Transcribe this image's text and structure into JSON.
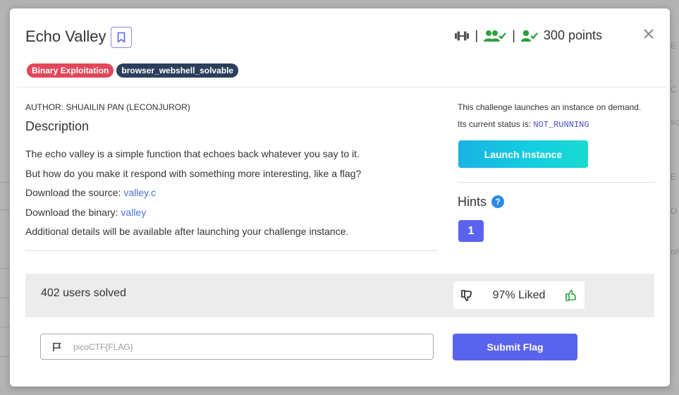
{
  "background": {
    "right_edge_fragments": [
      "E",
      "-C",
      "sc",
      "E",
      "O",
      "olv"
    ]
  },
  "header": {
    "title": "Echo Valley",
    "points": "300 points",
    "separator": "|"
  },
  "tags": [
    {
      "label": "Binary Exploitation",
      "color": "#e2475a"
    },
    {
      "label": "browser_webshell_solvable",
      "color": "#2c3e5c"
    }
  ],
  "details": {
    "author": "AUTHOR: SHUAILIN PAN (LECONJUROR)",
    "description_heading": "Description",
    "line1": "The echo valley is a simple function that echoes back whatever you say to it.",
    "line2": "But how do you make it respond with something more interesting, like a flag?",
    "source_prefix": "Download the source: ",
    "source_link": "valley.c",
    "binary_prefix": "Download the binary: ",
    "binary_link": "valley",
    "line5": "Additional details will be available after launching your challenge instance."
  },
  "instance": {
    "line1": "This challenge launches an instance on demand.",
    "status_prefix": "Its current status is: ",
    "status": "NOT_RUNNING",
    "launch_label": "Launch Instance"
  },
  "hints": {
    "label": "Hints",
    "help_glyph": "?",
    "items": [
      "1"
    ]
  },
  "stats": {
    "solved": "402 users solved",
    "liked": "97% Liked"
  },
  "flag": {
    "placeholder": "picoCTF{FLAG}",
    "value": "",
    "submit_label": "Submit Flag"
  },
  "icons": {
    "difficulty": "dumbbell-icon",
    "solved_users": "users-check-icon",
    "user_check": "user-check-icon",
    "bookmark": "bookmark-icon",
    "close": "close-icon",
    "thumbs_down": "thumbs-down-icon",
    "thumbs_up": "thumbs-up-icon",
    "flag": "flag-icon"
  },
  "colors": {
    "accent": "#5a63ee",
    "success_green": "#2e9e3e",
    "link": "#4b6fd6",
    "status_mono": "#4a50c8"
  }
}
